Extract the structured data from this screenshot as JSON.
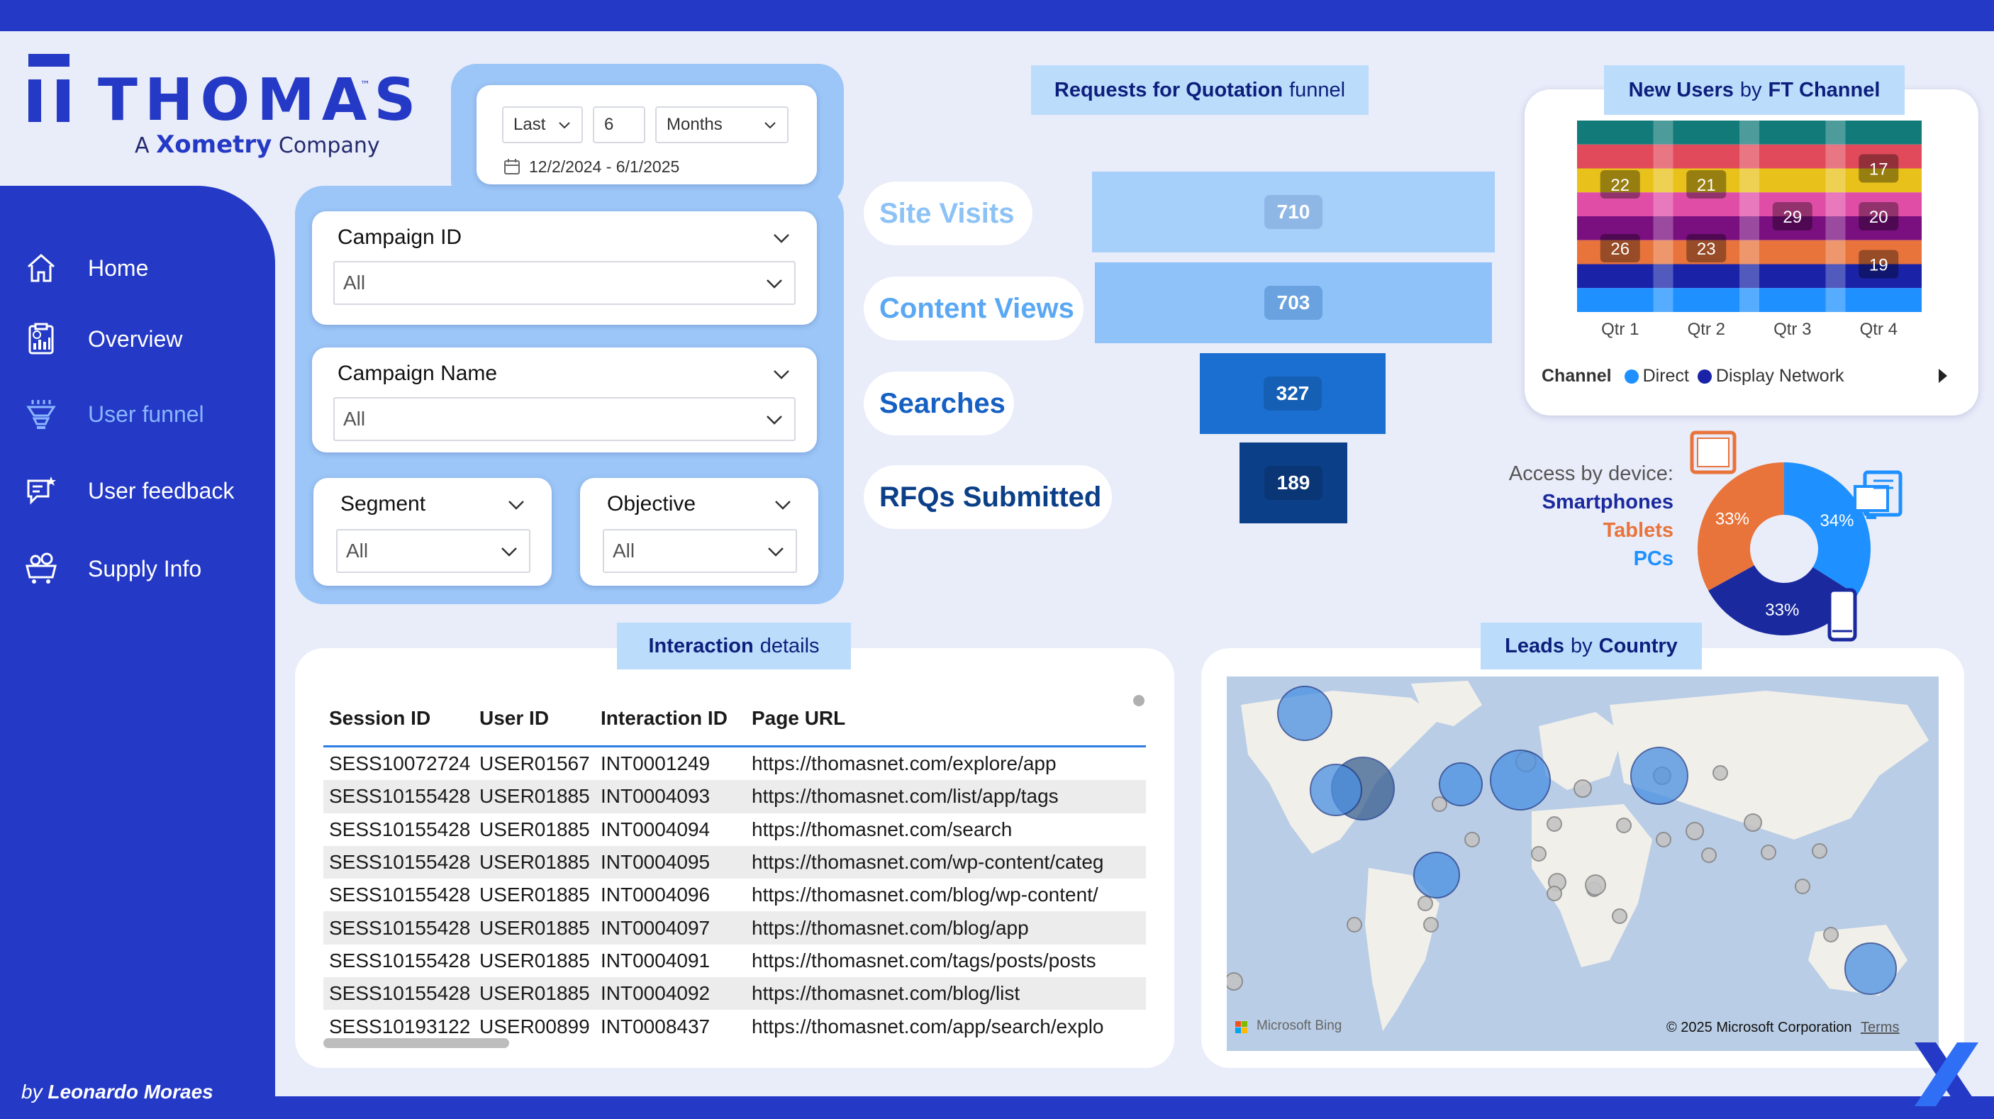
{
  "brand": {
    "name": "THOMAS",
    "trademark": "™",
    "sub_prefix": "A",
    "sub_brand": "Xometry",
    "sub_suffix": "Company"
  },
  "nav": {
    "items": [
      {
        "label": "Home",
        "icon": "home-icon"
      },
      {
        "label": "Overview",
        "icon": "report-icon"
      },
      {
        "label": "User funnel",
        "icon": "funnel-icon",
        "active": true
      },
      {
        "label": "User feedback",
        "icon": "feedback-icon"
      },
      {
        "label": "Supply Info",
        "icon": "supply-icon"
      }
    ],
    "byline_prefix": "by",
    "byline_name": "Leonardo Moraes"
  },
  "filters": {
    "date": {
      "relative": "Last",
      "count": "6",
      "unit": "Months",
      "range": "12/2/2024 - 6/1/2025"
    },
    "campaign_id": {
      "title": "Campaign ID",
      "value": "All"
    },
    "campaign_name": {
      "title": "Campaign Name",
      "value": "All"
    },
    "segment": {
      "title": "Segment",
      "value": "All"
    },
    "objective": {
      "title": "Objective",
      "value": "All"
    }
  },
  "funnel": {
    "title_bold": "Requests for Quotation",
    "title_rest": "funnel",
    "stages": [
      {
        "label": "Site Visits",
        "value": "710",
        "color": "#a6cff9",
        "label_color": "#8cc2f6"
      },
      {
        "label": "Content Views",
        "value": "703",
        "color": "#8ec2f8",
        "label_color": "#5aa8f3"
      },
      {
        "label": "Searches",
        "value": "327",
        "color": "#1b6fd0",
        "label_color": "#1660c4"
      },
      {
        "label": "RFQs Submitted",
        "value": "189",
        "color": "#0b3f88",
        "label_color": "#0b3f88"
      }
    ]
  },
  "new_users": {
    "title_bold1": "New Users",
    "title_mid": "by",
    "title_bold2": "FT Channel",
    "legend_title": "Channel",
    "legend_items": [
      {
        "name": "Direct",
        "color": "#1e90ff"
      },
      {
        "name": "Display Network",
        "color": "#1a23a8"
      }
    ],
    "chart_data": {
      "type": "ribbon",
      "categories": [
        "Qtr 1",
        "Qtr 2",
        "Qtr 3",
        "Qtr 4"
      ],
      "data_labels": [
        {
          "category": "Qtr 1",
          "value": "22"
        },
        {
          "category": "Qtr 1",
          "value": "26"
        },
        {
          "category": "Qtr 2",
          "value": "21"
        },
        {
          "category": "Qtr 2",
          "value": "23"
        },
        {
          "category": "Qtr 3",
          "value": "29"
        },
        {
          "category": "Qtr 4",
          "value": "17"
        },
        {
          "category": "Qtr 4",
          "value": "20"
        },
        {
          "category": "Qtr 4",
          "value": "19"
        }
      ]
    }
  },
  "device": {
    "caption": "Access by device:",
    "labels": [
      {
        "name": "Smartphones",
        "color": "#1a2a9e"
      },
      {
        "name": "Tablets",
        "color": "#e8743b"
      },
      {
        "name": "PCs",
        "color": "#1e90ff"
      }
    ],
    "chart_data": {
      "type": "pie",
      "slices": [
        {
          "name": "PCs",
          "value": 34,
          "label": "34%",
          "color": "#1e90ff"
        },
        {
          "name": "Smartphones",
          "value": 33,
          "label": "33%",
          "color": "#1a2a9e"
        },
        {
          "name": "Tablets",
          "value": 33,
          "label": "33%",
          "color": "#e8743b"
        }
      ]
    }
  },
  "interactions": {
    "title_bold": "Interaction",
    "title_rest": "details",
    "columns": [
      "Session ID",
      "User ID",
      "Interaction ID",
      "Page URL"
    ],
    "rows": [
      [
        "SESS10072724",
        "USER01567",
        "INT0001249",
        "https://thomasnet.com/explore/app"
      ],
      [
        "SESS10155428",
        "USER01885",
        "INT0004093",
        "https://thomasnet.com/list/app/tags"
      ],
      [
        "SESS10155428",
        "USER01885",
        "INT0004094",
        "https://thomasnet.com/search"
      ],
      [
        "SESS10155428",
        "USER01885",
        "INT0004095",
        "https://thomasnet.com/wp-content/categ"
      ],
      [
        "SESS10155428",
        "USER01885",
        "INT0004096",
        "https://thomasnet.com/blog/wp-content/"
      ],
      [
        "SESS10155428",
        "USER01885",
        "INT0004097",
        "https://thomasnet.com/blog/app"
      ],
      [
        "SESS10155428",
        "USER01885",
        "INT0004091",
        "https://thomasnet.com/tags/posts/posts"
      ],
      [
        "SESS10155428",
        "USER01885",
        "INT0004092",
        "https://thomasnet.com/blog/list"
      ],
      [
        "SESS10193122",
        "USER00899",
        "INT0008437",
        "https://thomasnet.com/app/search/explo"
      ]
    ]
  },
  "leads_map": {
    "title_bold1": "Leads",
    "title_mid": "by",
    "title_bold2": "Country",
    "attribution_left": "Microsoft Bing",
    "attribution_right": "© 2025 Microsoft Corporation",
    "terms": "Terms"
  },
  "colors": {
    "brand_blue": "#2439c5",
    "panel_bg": "#e9ecf9",
    "filter_bg": "#9cc6f7"
  }
}
